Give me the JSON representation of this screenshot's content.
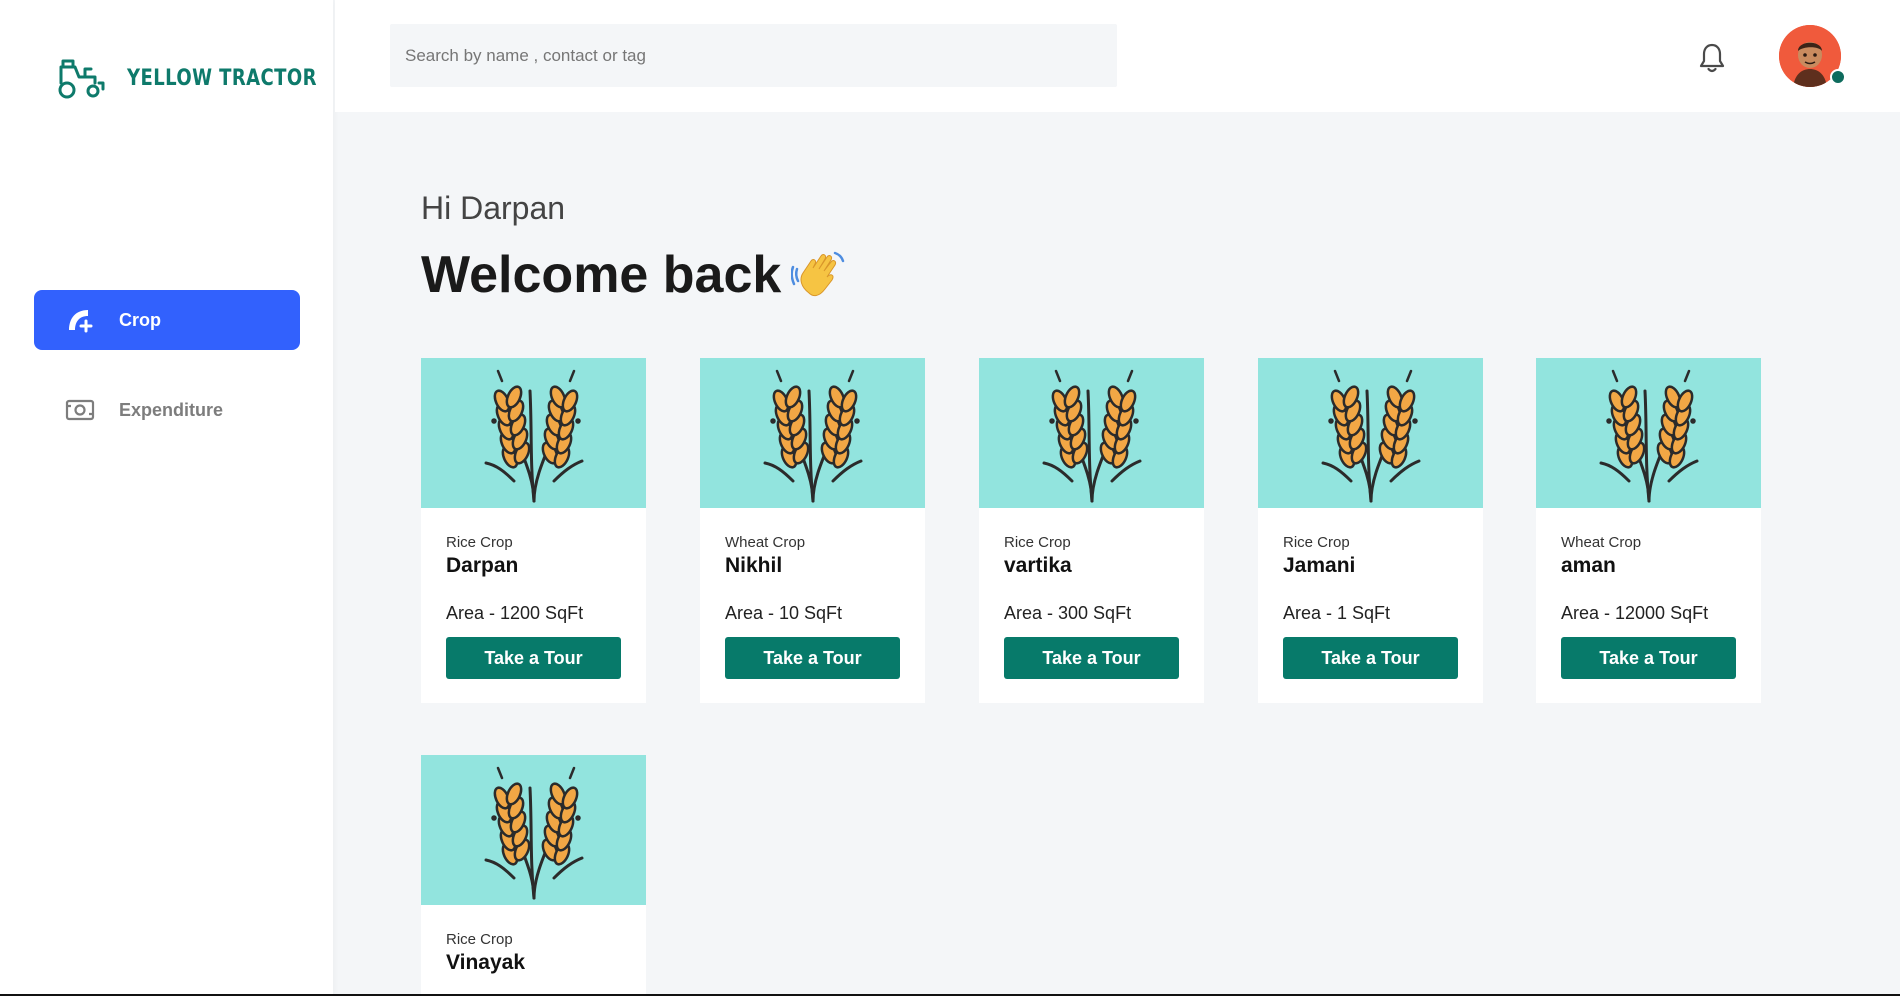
{
  "brand": {
    "name": "YELLOW TRACTOR",
    "icon": "tractor-icon",
    "color": "#0e7a6b"
  },
  "sidebar": {
    "items": [
      {
        "label": "Crop",
        "icon": "crop-add-icon",
        "active": true
      },
      {
        "label": "Expenditure",
        "icon": "money-icon",
        "active": false
      }
    ]
  },
  "header": {
    "search_placeholder": "Search by name , contact or tag",
    "notification_icon": "bell-icon",
    "avatar_icon": "user-avatar",
    "status": "online"
  },
  "main": {
    "greeting": "Hi Darpan",
    "welcome": "Welcome back",
    "wave_icon": "waving-hand-icon",
    "cards": [
      {
        "type": "Rice Crop",
        "owner": "Darpan",
        "area": "Area - 1200 SqFt",
        "button": "Take a Tour"
      },
      {
        "type": "Wheat Crop",
        "owner": "Nikhil",
        "area": "Area - 10 SqFt",
        "button": "Take a Tour"
      },
      {
        "type": "Rice Crop",
        "owner": "vartika",
        "area": "Area - 300 SqFt",
        "button": "Take a Tour"
      },
      {
        "type": "Rice Crop",
        "owner": "Jamani",
        "area": "Area - 1 SqFt",
        "button": "Take a Tour"
      },
      {
        "type": "Wheat Crop",
        "owner": "aman",
        "area": "Area - 12000 SqFt",
        "button": "Take a Tour"
      },
      {
        "type": "Rice Crop",
        "owner": "Vinayak",
        "area": "",
        "button": ""
      }
    ]
  },
  "colors": {
    "accent": "#3261fd",
    "button": "#077a6a",
    "thumb_bg": "#92e4de",
    "page_bg": "#f4f6f8"
  }
}
